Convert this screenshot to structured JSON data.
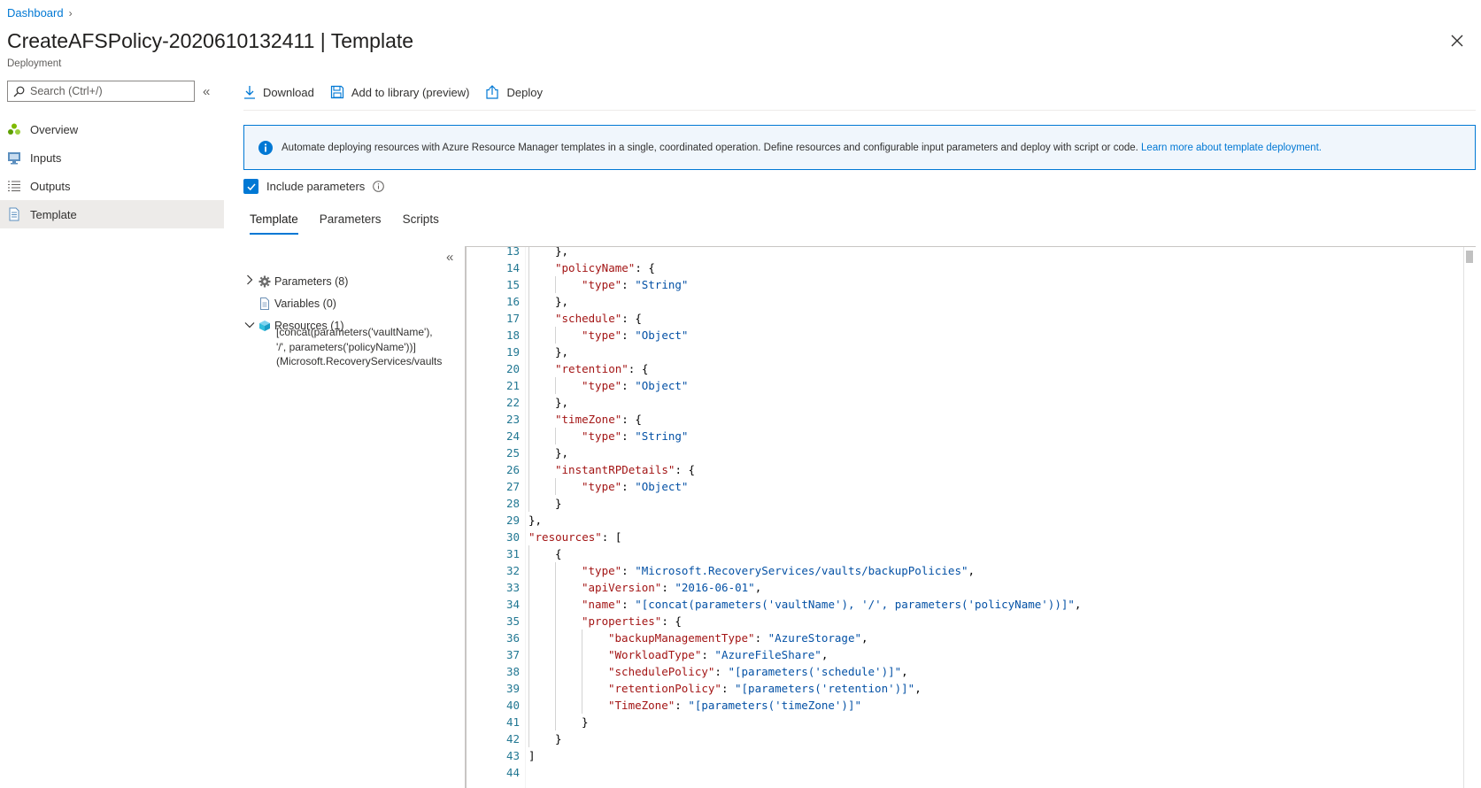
{
  "breadcrumb": {
    "dashboard": "Dashboard"
  },
  "header": {
    "title": "CreateAFSPolicy-2020610132411",
    "separator": "|",
    "section": "Template",
    "subtitle": "Deployment"
  },
  "search": {
    "placeholder": "Search (Ctrl+/)"
  },
  "nav": {
    "items": [
      {
        "label": "Overview",
        "icon": "overview-icon"
      },
      {
        "label": "Inputs",
        "icon": "inputs-icon"
      },
      {
        "label": "Outputs",
        "icon": "outputs-icon"
      },
      {
        "label": "Template",
        "icon": "template-icon"
      }
    ],
    "active": "Template"
  },
  "toolbar": {
    "download": "Download",
    "add_library": "Add to library (preview)",
    "deploy": "Deploy"
  },
  "info": {
    "text": "Automate deploying resources with Azure Resource Manager templates in a single, coordinated operation. Define resources and configurable input parameters and deploy with script or code.",
    "link": "Learn more about template deployment."
  },
  "include_params": {
    "label": "Include parameters",
    "checked": true
  },
  "tabs": [
    "Template",
    "Parameters",
    "Scripts"
  ],
  "tree": {
    "parameters": "Parameters (8)",
    "variables": "Variables (0)",
    "resources": "Resources (1)",
    "resource_lines": [
      "[concat(parameters('vaultName'),",
      "'/', parameters('policyName'))]",
      "(Microsoft.RecoveryServices/vaults"
    ]
  },
  "editor": {
    "lines": [
      {
        "n": "13",
        "indent": 2,
        "code": "},"
      },
      {
        "n": "14",
        "indent": 2,
        "key": "\"policyName\"",
        "rest": ": {"
      },
      {
        "n": "15",
        "indent": 3,
        "key": "\"type\"",
        "rest": ": ",
        "str": "\"String\""
      },
      {
        "n": "16",
        "indent": 2,
        "code": "},"
      },
      {
        "n": "17",
        "indent": 2,
        "key": "\"schedule\"",
        "rest": ": {"
      },
      {
        "n": "18",
        "indent": 3,
        "key": "\"type\"",
        "rest": ": ",
        "str": "\"Object\""
      },
      {
        "n": "19",
        "indent": 2,
        "code": "},"
      },
      {
        "n": "20",
        "indent": 2,
        "key": "\"retention\"",
        "rest": ": {"
      },
      {
        "n": "21",
        "indent": 3,
        "key": "\"type\"",
        "rest": ": ",
        "str": "\"Object\""
      },
      {
        "n": "22",
        "indent": 2,
        "code": "},"
      },
      {
        "n": "23",
        "indent": 2,
        "key": "\"timeZone\"",
        "rest": ": {"
      },
      {
        "n": "24",
        "indent": 3,
        "key": "\"type\"",
        "rest": ": ",
        "str": "\"String\""
      },
      {
        "n": "25",
        "indent": 2,
        "code": "},"
      },
      {
        "n": "26",
        "indent": 2,
        "key": "\"instantRPDetails\"",
        "rest": ": {"
      },
      {
        "n": "27",
        "indent": 3,
        "key": "\"type\"",
        "rest": ": ",
        "str": "\"Object\""
      },
      {
        "n": "28",
        "indent": 2,
        "code": "}"
      },
      {
        "n": "29",
        "indent": 1,
        "code": "},"
      },
      {
        "n": "30",
        "indent": 1,
        "key": "\"resources\"",
        "rest": ": ["
      },
      {
        "n": "31",
        "indent": 2,
        "code": "{"
      },
      {
        "n": "32",
        "indent": 3,
        "key": "\"type\"",
        "rest": ": ",
        "str": "\"Microsoft.RecoveryServices/vaults/backupPolicies\"",
        "tail": ","
      },
      {
        "n": "33",
        "indent": 3,
        "key": "\"apiVersion\"",
        "rest": ": ",
        "str": "\"2016-06-01\"",
        "tail": ","
      },
      {
        "n": "34",
        "indent": 3,
        "key": "\"name\"",
        "rest": ": ",
        "str": "\"[concat(parameters('vaultName'), '/', parameters('policyName'))]\"",
        "tail": ","
      },
      {
        "n": "35",
        "indent": 3,
        "key": "\"properties\"",
        "rest": ": {"
      },
      {
        "n": "36",
        "indent": 4,
        "key": "\"backupManagementType\"",
        "rest": ": ",
        "str": "\"AzureStorage\"",
        "tail": ","
      },
      {
        "n": "37",
        "indent": 4,
        "key": "\"WorkloadType\"",
        "rest": ": ",
        "str": "\"AzureFileShare\"",
        "tail": ","
      },
      {
        "n": "38",
        "indent": 4,
        "key": "\"schedulePolicy\"",
        "rest": ": ",
        "str": "\"[parameters('schedule')]\"",
        "tail": ","
      },
      {
        "n": "39",
        "indent": 4,
        "key": "\"retentionPolicy\"",
        "rest": ": ",
        "str": "\"[parameters('retention')]\"",
        "tail": ","
      },
      {
        "n": "40",
        "indent": 4,
        "key": "\"TimeZone\"",
        "rest": ": ",
        "str": "\"[parameters('timeZone')]\""
      },
      {
        "n": "41",
        "indent": 3,
        "code": "}"
      },
      {
        "n": "42",
        "indent": 2,
        "code": "}"
      },
      {
        "n": "43",
        "indent": 1,
        "code": "]"
      },
      {
        "n": "44",
        "indent": 0,
        "code": ""
      }
    ]
  },
  "colors": {
    "accent": "#0078d4",
    "json_key": "#a31515",
    "json_string": "#0451a5",
    "line_number": "#237893"
  }
}
